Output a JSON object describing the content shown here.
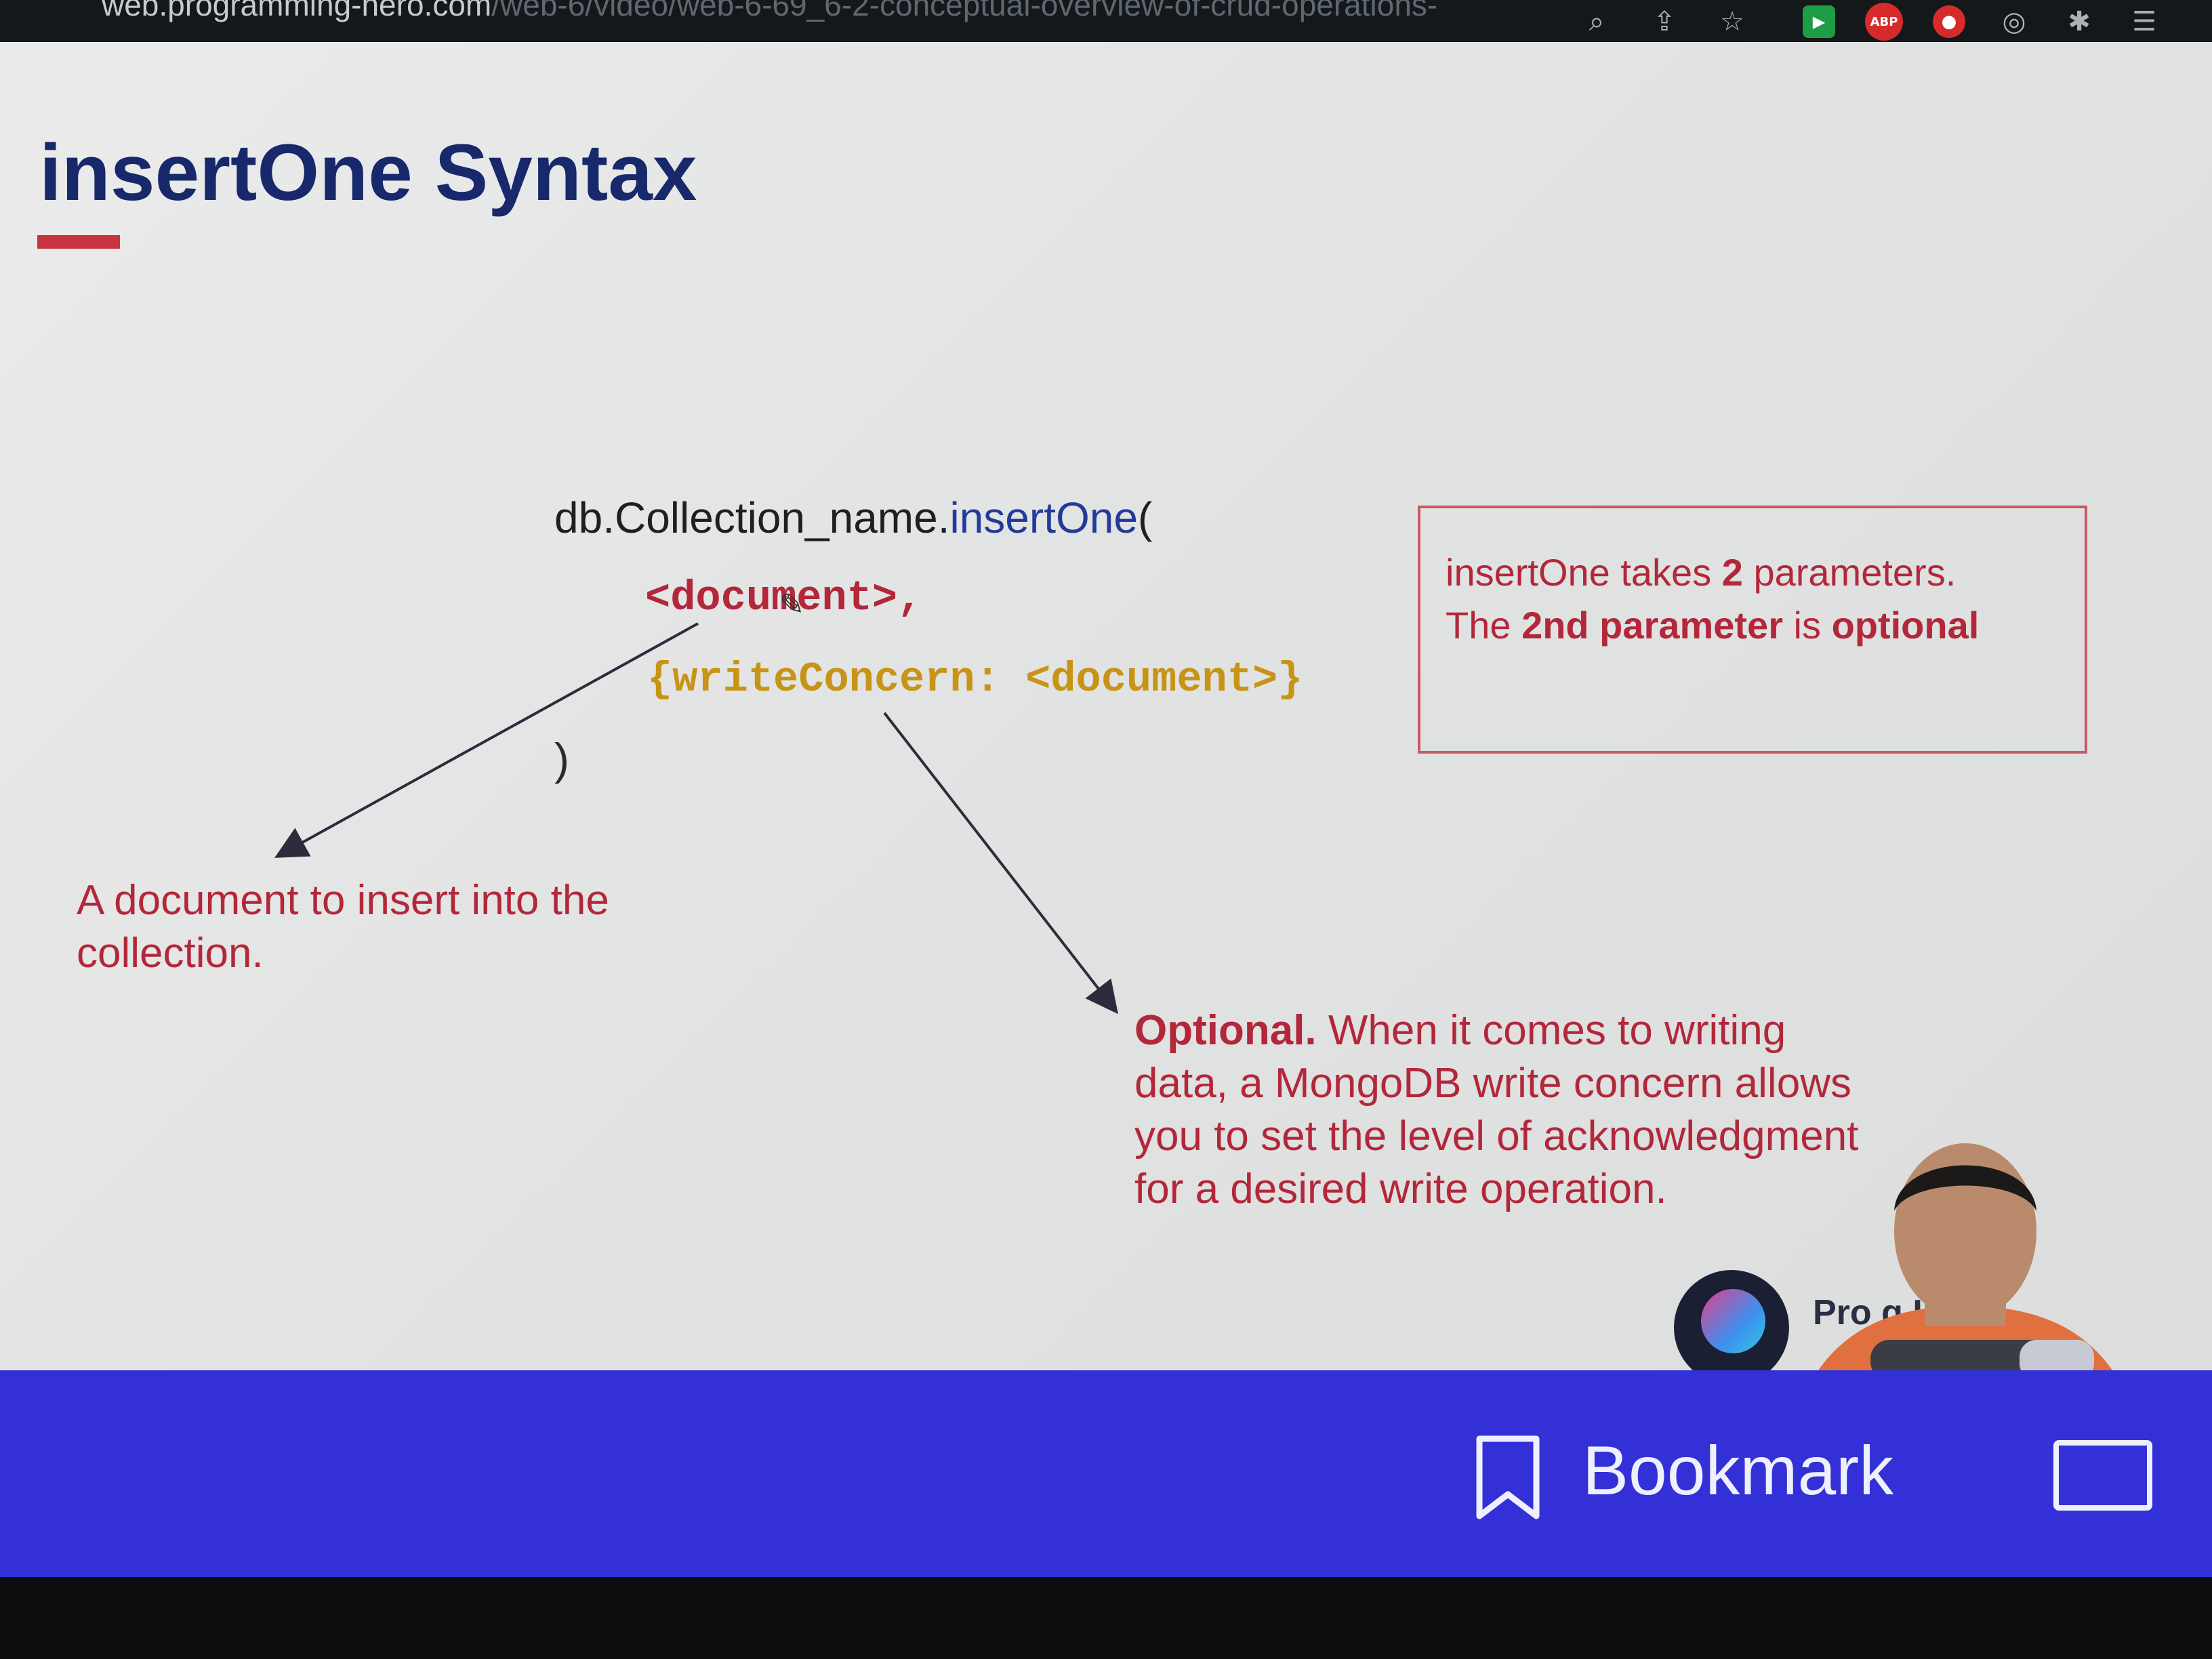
{
  "browser": {
    "url_host": "web.programming-hero.com",
    "url_path": "/web-6/video/web-6-69_6-2-conceptual-overview-of-crud-operations-",
    "icons": [
      "search-icon",
      "share-icon",
      "star-icon",
      "extension-green-icon",
      "adblock-icon",
      "extension-red-icon",
      "extension-circle-icon",
      "puzzle-icon",
      "reading-list-icon"
    ],
    "adblock_label": "ABP"
  },
  "slide": {
    "title": "insertOne Syntax",
    "code": {
      "line1_prefix": "db.Collection_name.",
      "line1_method": "insertOne",
      "line1_paren": "(",
      "line2": "<document>,",
      "line3": "{writeConcern: <document>}",
      "line4": ")"
    },
    "note_document": "A document to insert into the collection.",
    "note_optional_bold": "Optional.",
    "note_optional_text": " When it comes to writing data, a MongoDB write concern allows you to set the level of acknowledgment for a desired write operation.",
    "info": {
      "l1_a": "insertOne  takes ",
      "l1_b": "2",
      "l1_c": "  parameters.",
      "l2_a": "The ",
      "l2_b": "2nd  parameter",
      "l2_c": " is ",
      "l2_d": "optional"
    },
    "brand_text": "Pro          g Hero",
    "colors": {
      "title": "#17296a",
      "accent": "#c8343f",
      "code_doc": "#b3273a",
      "code_wc": "#c79416",
      "method": "#243a9a"
    }
  },
  "bottom_bar": {
    "bookmark_label": "Bookmark",
    "background": "#3330d7"
  }
}
